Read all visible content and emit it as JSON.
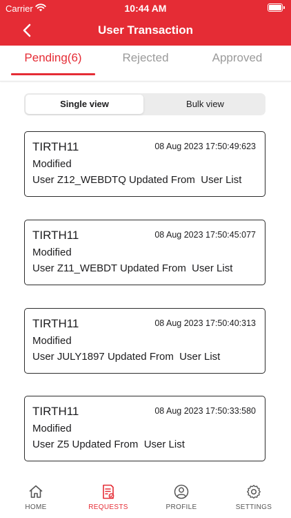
{
  "status_bar": {
    "carrier": "Carrier",
    "time": "10:44 AM"
  },
  "header": {
    "title": "User Transaction",
    "back_icon": "chevron-left-icon"
  },
  "tabs": [
    {
      "label": "Pending(6)",
      "active": true
    },
    {
      "label": "Rejected",
      "active": false
    },
    {
      "label": "Approved",
      "active": false
    }
  ],
  "view_toggle": {
    "options": [
      "Single view",
      "Bulk view"
    ],
    "selected": "Single view"
  },
  "transactions": [
    {
      "user": "TIRTH11",
      "timestamp": "08 Aug 2023 17:50:49:623",
      "action": "Modified",
      "description": "User Z12_WEBDTQ Updated From  User List"
    },
    {
      "user": "TIRTH11",
      "timestamp": "08 Aug 2023 17:50:45:077",
      "action": "Modified",
      "description": "User Z11_WEBDT Updated From  User List"
    },
    {
      "user": "TIRTH11",
      "timestamp": "08 Aug 2023 17:50:40:313",
      "action": "Modified",
      "description": "User JULY1897 Updated From  User List"
    },
    {
      "user": "TIRTH11",
      "timestamp": "08 Aug 2023 17:50:33:580",
      "action": "Modified",
      "description": "User Z5 Updated From  User List"
    }
  ],
  "bottom_nav": [
    {
      "label": "HOME",
      "icon": "home-icon",
      "active": false
    },
    {
      "label": "REQUESTS",
      "icon": "requests-icon",
      "active": true
    },
    {
      "label": "PROFILE",
      "icon": "profile-icon",
      "active": false
    },
    {
      "label": "SETTINGS",
      "icon": "gear-icon",
      "active": false
    }
  ],
  "colors": {
    "accent": "#e52c35",
    "card_border": "#2b2b2b",
    "inactive_tab": "#9a9a9a"
  }
}
